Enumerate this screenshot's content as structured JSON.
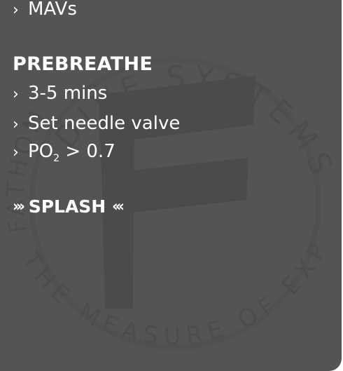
{
  "checklist": {
    "top_item": "MAVs",
    "section_title": "PREBREATHE",
    "items": [
      "3-5 mins",
      "Set needle valve"
    ],
    "po2": {
      "prefix": "PO",
      "subscript": "2",
      "suffix": " > 0.7"
    },
    "splash": {
      "left_arrows": "›››",
      "label": "SPLASH",
      "right_arrows": "‹‹‹"
    },
    "bullet": "›"
  },
  "watermark": {
    "top_text": "DIVE SYSTEMS",
    "left_text": "FATHOM",
    "bottom_text": "THE MEASURE OF EXPLORATION",
    "letter": "F"
  },
  "colors": {
    "background": "#545456",
    "text": "#ffffff",
    "watermark": "#4b4b4d"
  }
}
